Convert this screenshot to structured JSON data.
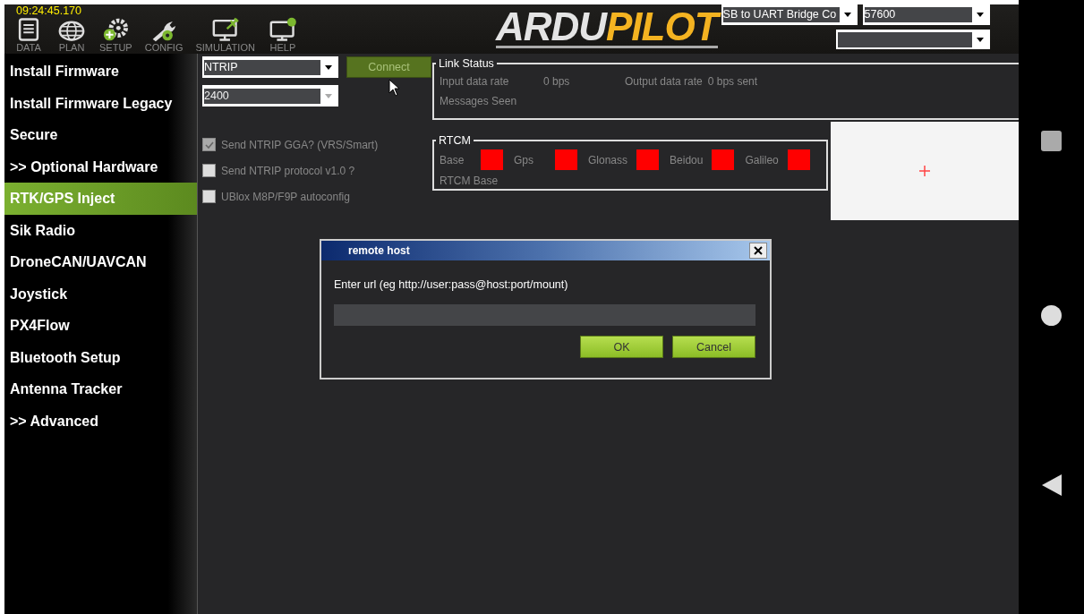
{
  "clock": "09:24:45.170",
  "toolbar": [
    {
      "label": "DATA",
      "kind": "document",
      "selected": false
    },
    {
      "label": "PLAN",
      "kind": "globe",
      "selected": false
    },
    {
      "label": "SETUP",
      "kind": "setup",
      "selected": false
    },
    {
      "label": "CONFIG",
      "kind": "config",
      "selected": false
    },
    {
      "label": "SIMULATION",
      "kind": "simulation",
      "selected": false
    },
    {
      "label": "HELP",
      "kind": "help",
      "selected": false
    }
  ],
  "logo": {
    "part_1": "ARDU",
    "part_2": "PILOT"
  },
  "connection": {
    "port": "SB to UART Bridge Co",
    "baud": "57600"
  },
  "sidebar": {
    "items": [
      {
        "label": "Install Firmware",
        "selected": false
      },
      {
        "label": "Install Firmware Legacy",
        "selected": false
      },
      {
        "label": "Secure",
        "selected": false
      },
      {
        "label": ">> Optional Hardware",
        "selected": false
      },
      {
        "label": "RTK/GPS Inject",
        "selected": true
      },
      {
        "label": "Sik Radio",
        "selected": false
      },
      {
        "label": "DroneCAN/UAVCAN",
        "selected": false
      },
      {
        "label": "Joystick",
        "selected": false
      },
      {
        "label": "PX4Flow",
        "selected": false
      },
      {
        "label": "Bluetooth Setup",
        "selected": false
      },
      {
        "label": "Antenna Tracker",
        "selected": false
      },
      {
        "label": ">> Advanced",
        "selected": false
      }
    ]
  },
  "inject": {
    "source": "NTRIP",
    "baud": "2400",
    "baud_disabled": true,
    "connect_button": {
      "label": "Connect",
      "disabled": true
    },
    "options": [
      {
        "label": "Send NTRIP GGA? (VRS/Smart)",
        "checked": true
      },
      {
        "label": "Send NTRIP protocol v1.0 ?",
        "checked": false
      },
      {
        "label": "UBlox M8P/F9P autoconfig",
        "checked": false
      }
    ]
  },
  "link_status": {
    "title": "Link Status",
    "input_label": "Input data rate",
    "input_value": "0 bps",
    "output_label": "Output data rate",
    "output_value": "0 bps sent",
    "messages_label": "Messages Seen"
  },
  "rtcm": {
    "title": "RTCM",
    "indicators": [
      {
        "label": "Base",
        "color": "#ff0000"
      },
      {
        "label": "Gps",
        "color": "#ff0000"
      },
      {
        "label": "Glonass",
        "color": "#ff0000"
      },
      {
        "label": "Beidou",
        "color": "#ff0000"
      },
      {
        "label": "Galileo",
        "color": "#ff0000"
      }
    ],
    "base_label": "RTCM Base"
  },
  "dialog": {
    "title": "remote host",
    "prompt": "Enter url (eg http://user:pass@host:port/mount)",
    "buttons": [
      "OK",
      "Cancel"
    ]
  }
}
